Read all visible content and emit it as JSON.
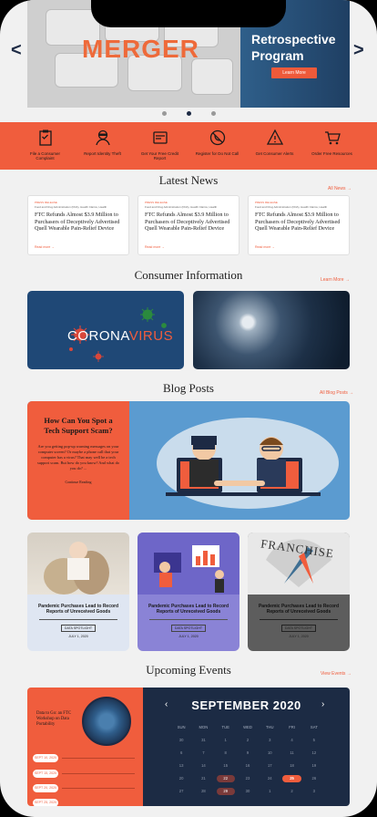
{
  "hero": {
    "image_word": "MERGER",
    "title": "Retrospective Program",
    "title_partial": "r",
    "button": "Learn More",
    "prev_icon": "chevron-left-icon",
    "next_icon": "chevron-right-icon",
    "slide_count": 3,
    "active_slide": 2
  },
  "actions": [
    {
      "label": "File a Consumer Complaint",
      "icon": "clipboard-icon"
    },
    {
      "label": "Report Identity Theft",
      "icon": "thief-icon"
    },
    {
      "label": "Get Your Free Credit Report",
      "icon": "credit-report-icon"
    },
    {
      "label": "Register for Do Not Call",
      "icon": "no-phone-icon"
    },
    {
      "label": "Get Consumer Alerts",
      "icon": "alert-icon"
    },
    {
      "label": "Order Free Resources",
      "icon": "cart-icon"
    }
  ],
  "news": {
    "title": "Latest News",
    "link": "All News →",
    "cards": [
      {
        "tag": "PRESS RELEASE",
        "category": "Food and Drug Administration (FDA), Health Claims, Health",
        "title": "FTC Refunds Almost $3.9 Million to Purchasers of Deceptively Advertised Quell Wearable Pain-Relief Device",
        "more": "Read more →"
      },
      {
        "tag": "PRESS RELEASE",
        "category": "Food and Drug Administration (FDA), Health Claims, Health",
        "title": "FTC Refunds Almost $3.9 Million to Purchasers of Deceptively Advertised Quell Wearable Pain-Relief Device",
        "more": "Read more →"
      },
      {
        "tag": "PRESS RELEASE",
        "category": "Food and Drug Administration (FDA), Health Claims, Health",
        "title": "FTC Refunds Almost $3.9 Million to Purchasers of Deceptively Advertised Quell Wearable Pain-Relief Device",
        "more": "Read more →"
      }
    ]
  },
  "consumer": {
    "title": "Consumer Information",
    "link": "Learn More →",
    "corona_a": "CORONA",
    "corona_b": "VIRUS"
  },
  "blog": {
    "title": "Blog Posts",
    "link": "All Blog Posts →",
    "featured": {
      "title": "How Can You Spot a Tech Support Scam?",
      "text": "Are you getting pop-up warning messages on your computer screen? Or maybe a phone call that your computer has a virus? That may well be a tech support scam. But how do you know? And what do you do? ...",
      "more": "Continue Reading"
    },
    "cards": [
      {
        "title": "Pandemic Purchases Lead to Record Reports of Unreceived Goods",
        "badge": "DATA SPOTLIGHT",
        "date": "JULY 1, 2020",
        "bg": "#dfe6f2"
      },
      {
        "title": "Pandemic Purchases Lead to Record Reports of Unreceived Goods",
        "badge": "DATA SPOTLIGHT",
        "date": "JULY 1, 2020",
        "bg": "#8a83d6"
      },
      {
        "title": "Pandemic Purchases Lead to Record Reports of Unreceived Goods",
        "badge": "DATA SPOTLIGHT",
        "date": "JULY 1, 2020",
        "bg": "#5d5d5d"
      }
    ],
    "franchise_word": "FRANCHISE"
  },
  "events": {
    "title": "Upcoming Events",
    "link": "View Events →",
    "featured": "Data to Go: an FTC Workshop on Data Portability",
    "dates": [
      "SEPT 10, 2020",
      "SEPT 15, 2020",
      "SEPT 20, 2020",
      "SEPT 25, 2020"
    ],
    "calendar": {
      "month": "SEPTEMBER 2020",
      "prev": "‹",
      "next": "›",
      "days_of_week": [
        "SUN",
        "MON",
        "TUE",
        "WED",
        "THU",
        "FRI",
        "SAT"
      ],
      "cells": [
        "30",
        "31",
        "1",
        "2",
        "3",
        "4",
        "5",
        "6",
        "7",
        "8",
        "9",
        "10",
        "11",
        "12",
        "13",
        "14",
        "15",
        "16",
        "17",
        "18",
        "19",
        "20",
        "21",
        "22",
        "23",
        "24",
        "25",
        "26",
        "27",
        "28",
        "29",
        "30",
        "1",
        "2",
        "3"
      ],
      "marked": [
        "22",
        "29"
      ],
      "today": "25"
    }
  },
  "colors": {
    "accent": "#f05d3d",
    "navy": "#1c2b44"
  }
}
